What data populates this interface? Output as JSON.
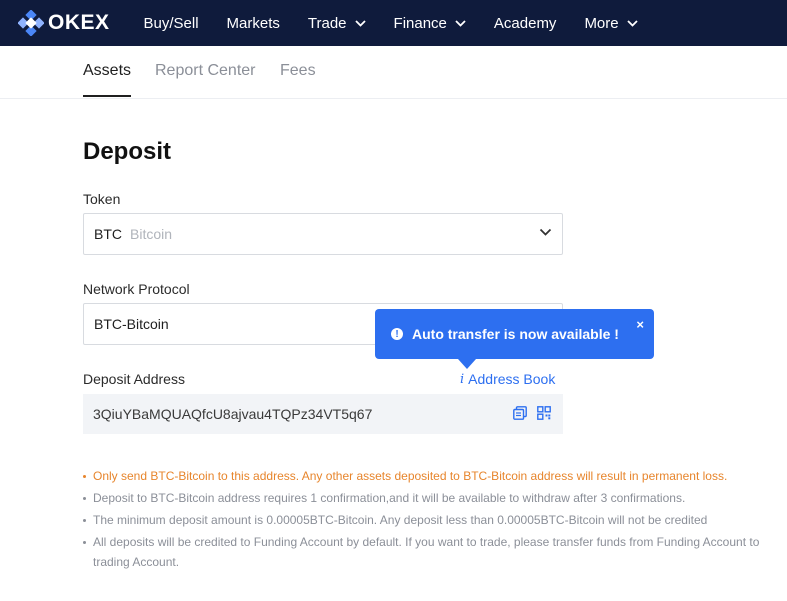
{
  "brand": {
    "name": "OKEX"
  },
  "nav": {
    "items": [
      {
        "label": "Buy/Sell",
        "dropdown": false
      },
      {
        "label": "Markets",
        "dropdown": false
      },
      {
        "label": "Trade",
        "dropdown": true
      },
      {
        "label": "Finance",
        "dropdown": true
      },
      {
        "label": "Academy",
        "dropdown": false
      },
      {
        "label": "More",
        "dropdown": true
      }
    ]
  },
  "subtabs": {
    "assets": "Assets",
    "report_center": "Report Center",
    "fees": "Fees",
    "active": "Assets"
  },
  "deposit": {
    "title": "Deposit",
    "token_label": "Token",
    "token_symbol": "BTC",
    "token_name": "Bitcoin",
    "network_label": "Network Protocol",
    "network_value": "BTC-Bitcoin",
    "address_label": "Deposit Address",
    "address_book": "Address Book",
    "address_value": "3QiuYBaMQUAQfcU8ajvau4TQPz34VT5q67"
  },
  "tooltip": {
    "text": "Auto transfer is now available !",
    "close": "×"
  },
  "notes": [
    "Only send BTC-Bitcoin to this address. Any other assets deposited to BTC-Bitcoin address will result in permanent loss.",
    "Deposit to BTC-Bitcoin address requires 1 confirmation,and it will be available to withdraw after 3 confirmations.",
    "The minimum deposit amount is 0.00005BTC-Bitcoin. Any deposit less than 0.00005BTC-Bitcoin will not be credited",
    "All deposits will be credited to Funding Account by default. If you want to trade, please transfer funds from Funding Account to trading Account."
  ],
  "colors": {
    "nav_bg": "#0f1b3c",
    "accent": "#2d6ff0",
    "warning": "#e7852c"
  }
}
